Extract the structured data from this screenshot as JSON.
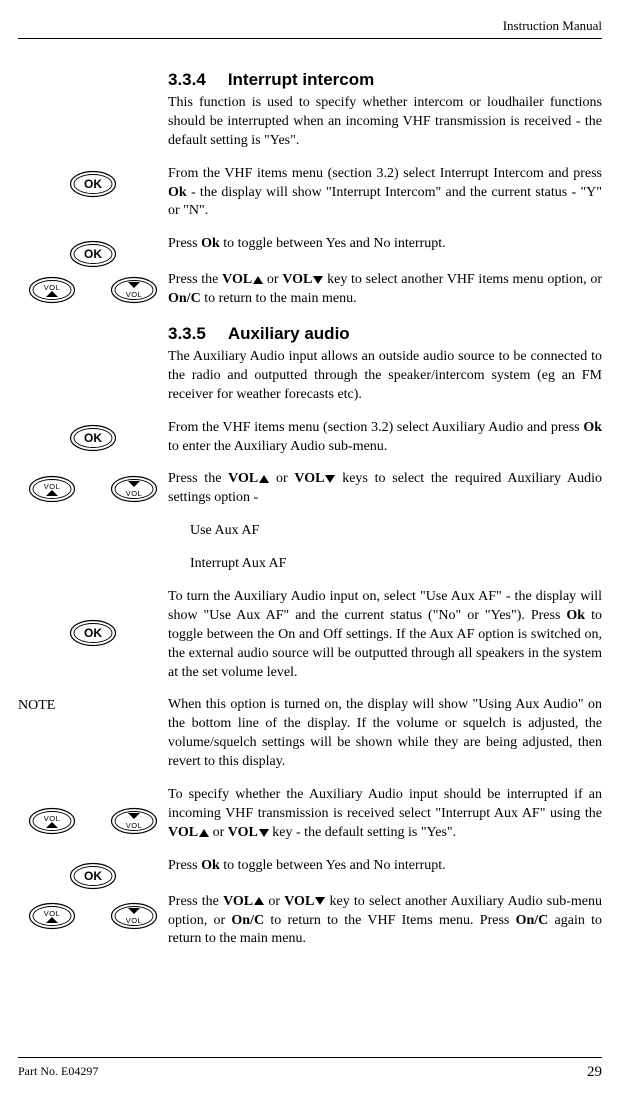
{
  "header": "Instruction Manual",
  "s1": {
    "num": "3.3.4",
    "title": "Interrupt intercom",
    "p1a": "This function is used to specify whether intercom or loudhailer functions should be interrupted when an incoming VHF transmission is received - the default setting is \"Yes\".",
    "p1b_a": "From the VHF items menu (section 3.2) select Interrupt Intercom and press ",
    "p1b_b": "Ok",
    "p1b_c": " - the display will show \"Interrupt Intercom\" and the current status - \"Y\" or \"N\".",
    "p1c_a": "Press ",
    "p1c_b": "Ok",
    "p1c_c": " to toggle between Yes and No interrupt.",
    "p1d_a": "Press the ",
    "p1d_b": "VOL",
    "p1d_c": " or ",
    "p1d_d": "VOL",
    "p1d_e": " key to select another VHF items menu option, or ",
    "p1d_f": "On/C",
    "p1d_g": " to return to the main menu."
  },
  "s2": {
    "num": "3.3.5",
    "title": "Auxiliary audio",
    "p1": "The Auxiliary Audio input allows an outside audio source to be connected to the radio and outputted through the speaker/intercom system (eg an FM receiver for weather forecasts etc).",
    "p2a": "From the VHF items menu (section 3.2) select Auxiliary Audio and press ",
    "p2b": "Ok",
    "p2c": " to enter the Auxiliary Audio sub-menu.",
    "p3a": "Press the ",
    "p3b": "VOL",
    "p3c": " or ",
    "p3d": "VOL",
    "p3e": " keys to select the required Auxiliary Audio settings option -",
    "opt1": "Use Aux AF",
    "opt2": "Interrupt Aux AF",
    "p4a": "To turn the Auxiliary Audio input on, select \"Use Aux AF\" - the display will show \"Use Aux AF\" and the current status (\"No\" or \"Yes\").  Press ",
    "p4b": "Ok",
    "p4c": " to toggle between the On and Off settings.  If the Aux AF option is switched on, the external audio source will be outputted through all speakers in the system at the set volume level.",
    "note_label": "NOTE",
    "p5": "When this option is turned on, the display will show \"Using Aux Audio\" on the bottom line of the display.   If the volume or squelch is adjusted, the volume/squelch settings will be shown while they are being adjusted, then revert to this display.",
    "p6a": "To specify whether the Auxiliary Audio input should be interrupted if an incoming VHF transmission is received select \"Interrupt Aux AF\" using the ",
    "p6b": "VOL",
    "p6c": " or ",
    "p6d": "VOL",
    "p6e": " key - the default setting is \"Yes\".",
    "p7a": "Press ",
    "p7b": "Ok",
    "p7c": " to toggle between Yes and No interrupt.",
    "p8a": "Press the ",
    "p8b": "VOL",
    "p8c": " or ",
    "p8d": "VOL",
    "p8e": " key to select another Auxiliary Audio sub-menu option, or ",
    "p8f": "On/C",
    "p8g": " to return to the VHF Items menu.  Press ",
    "p8h": "On/C",
    "p8i": " again to return to the main menu."
  },
  "footer": {
    "part": "Part No. E04297",
    "page": "29"
  },
  "btn": {
    "ok": "OK",
    "vol": "VOL"
  }
}
